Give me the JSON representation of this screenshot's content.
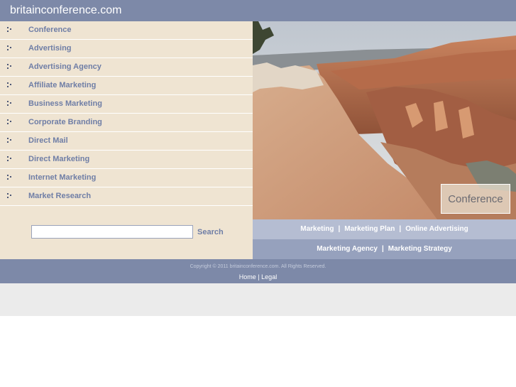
{
  "site": {
    "title": "britainconference.com"
  },
  "nav": {
    "items": [
      {
        "label": "Conference"
      },
      {
        "label": "Advertising"
      },
      {
        "label": "Advertising Agency"
      },
      {
        "label": "Affiliate Marketing"
      },
      {
        "label": "Business Marketing"
      },
      {
        "label": "Corporate Branding"
      },
      {
        "label": "Direct Mail"
      },
      {
        "label": "Direct Marketing"
      },
      {
        "label": "Internet Marketing"
      },
      {
        "label": "Market Research"
      }
    ]
  },
  "search": {
    "value": "",
    "button_label": "Search"
  },
  "hero": {
    "badge": "Conference"
  },
  "links": {
    "row1": [
      "Marketing",
      "Marketing Plan",
      "Online Advertising"
    ],
    "row2": [
      "Marketing Agency",
      "Marketing Strategy"
    ],
    "separator": "|"
  },
  "footer": {
    "copyright": "Copyright © 2011 britainconference.com. All Rights Reserved.",
    "home": "Home",
    "separator": "|",
    "legal": "Legal"
  },
  "colors": {
    "header": "#7d89a8",
    "sidebar": "#efe4d2",
    "nav_text": "#6f7ea6",
    "links_bar_1": "#b5bdd2",
    "links_bar_2": "#96a1bd"
  }
}
